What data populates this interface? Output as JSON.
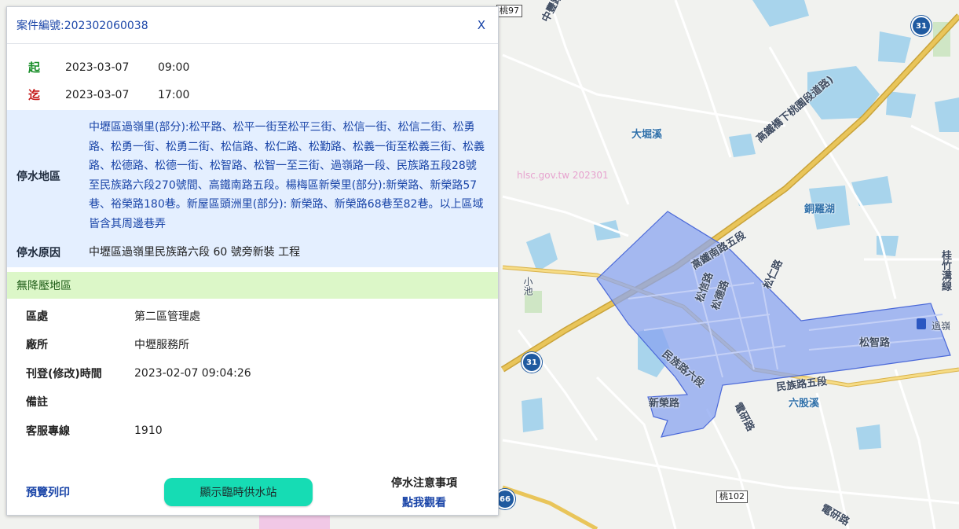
{
  "panel": {
    "title": "案件編號:202302060038",
    "close_label": "X",
    "start": {
      "mark": "起",
      "date": "2023-03-07",
      "time": "09:00"
    },
    "end": {
      "mark": "迄",
      "date": "2023-03-07",
      "time": "17:00"
    },
    "area_label": "停水地區",
    "area_text": "中壢區過嶺里(部分):松平路、松平一街至松平三街、松信一街、松信二街、松勇路、松勇一街、松勇二街、松信路、松仁路、松勤路、松義一街至松義三街、松義路、松德路、松德一街、松智路、松智一至三街、過嶺路一段、民族路五段28號至民族路六段270號間、高鐵南路五段。楊梅區新榮里(部分):新榮路、新榮路57巷、裕榮路180巷。新屋區頭洲里(部分): 新榮路、新榮路68巷至82巷。以上區域皆含其周邊巷弄",
    "reason_label": "停水原因",
    "reason_text": "中壢區過嶺里民族路六段 60 號旁新裝 工程",
    "pressure_text": "無降壓地區",
    "details": [
      {
        "key": "區處",
        "value": "第二區管理處"
      },
      {
        "key": "廠所",
        "value": "中壢服務所"
      },
      {
        "key": "刊登(修改)時間",
        "value": "2023-02-07 09:04:26"
      },
      {
        "key": "備註",
        "value": ""
      },
      {
        "key": "客服專線",
        "value": "1910"
      }
    ],
    "print_label": "預覽列印",
    "station_button": "顯示臨時供水站",
    "notice_title": "停水注意事項",
    "notice_link": "點我觀看"
  },
  "map": {
    "labels": {
      "dapi": "大堀溪",
      "hsr_road": "高鐵橋下桃園段道路)",
      "tongluo": "銅羅湖",
      "guizhu": "桂竹溝線",
      "songzhi": "松智路",
      "guoling": "過嶺",
      "minzu5": "民族路五段",
      "minzu6": "民族路六段",
      "liugu": "六股溪",
      "xinrong": "新榮路",
      "dianyan1": "電研路",
      "dianyan2": "電研路",
      "hsr_south": "高鐵南路五段",
      "zhongfeng": "中豐路",
      "songren": "松仁路",
      "songde": "松德路",
      "songxin": "松信路",
      "xiaoshi": "小池",
      "watermark": "hlsc.gov.tw 202301"
    },
    "shields": {
      "n31a": "31",
      "n31b": "31",
      "n66": "66"
    },
    "tags": {
      "tao97": "桃97",
      "tao102": "桃102"
    },
    "polygon_color": "#8aa4f0"
  }
}
